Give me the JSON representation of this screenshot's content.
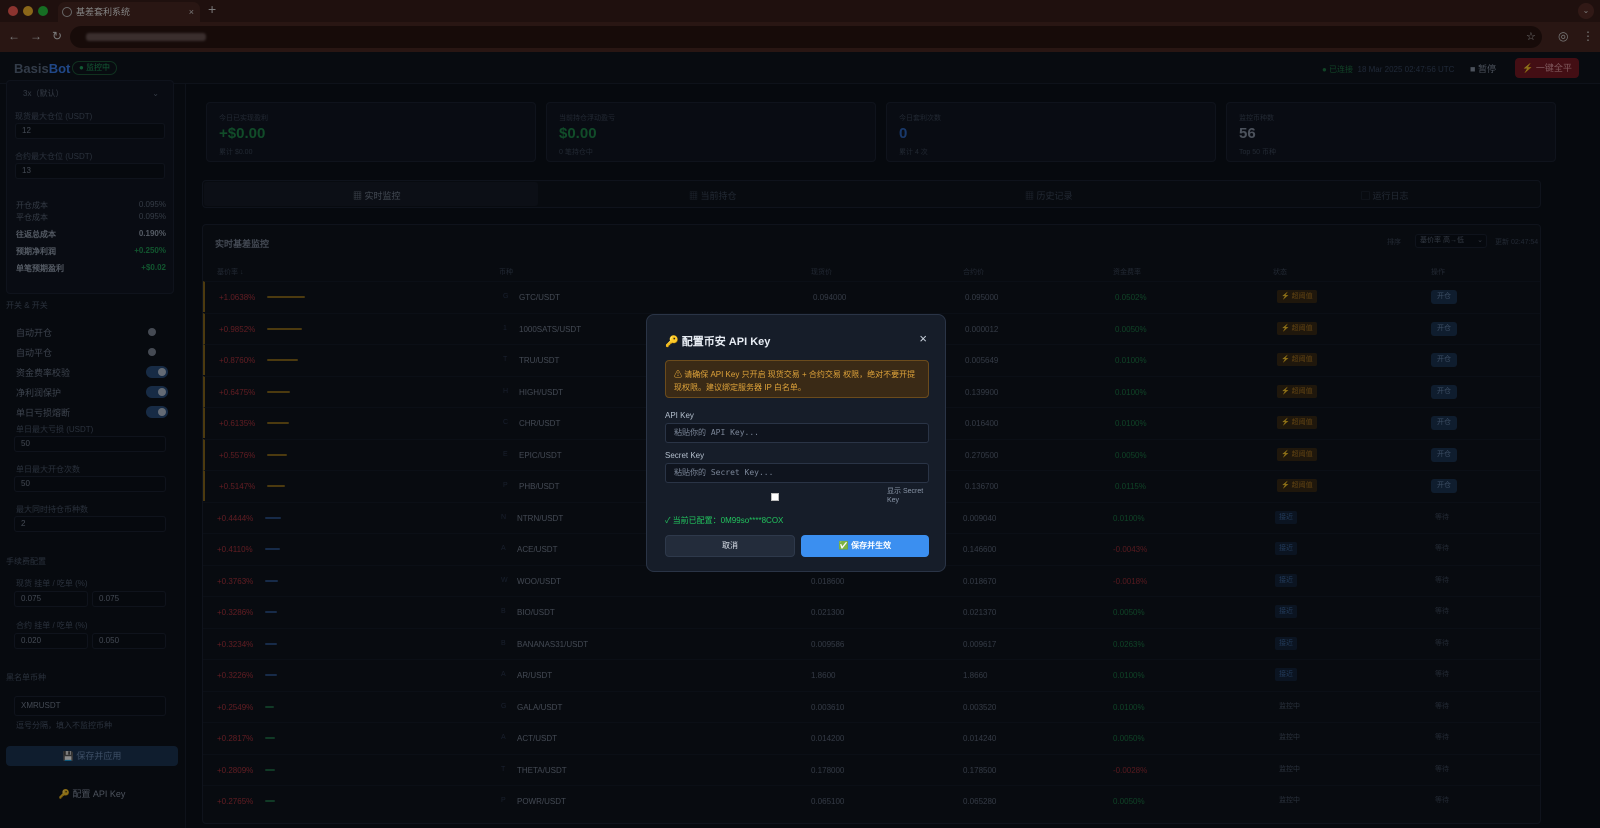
{
  "browser": {
    "tab_title": "基差套利系统",
    "new_tab": "+"
  },
  "header": {
    "brand_a": "Basis",
    "brand_b": "Bot",
    "status_badge": "● 监控中",
    "conn_status": "● 已连接",
    "datetime": "18 Mar 2025 02:47:56 UTC",
    "pause_label": "暂停",
    "close_all_label": "一键全平"
  },
  "sidebar": {
    "leverage": "3x（默认）",
    "spot_max_label": "现货最大仓位 (USDT)",
    "spot_max_value": "12",
    "fut_max_label": "合约最大仓位 (USDT)",
    "fut_max_value": "13",
    "cost_rows": [
      {
        "label": "开仓成本",
        "value": "0.095%"
      },
      {
        "label": "平仓成本",
        "value": "0.095%"
      }
    ],
    "total_cost_label": "往返总成本",
    "total_cost_value": "0.190%",
    "net_rate_label": "预期净利润",
    "net_rate_value": "+0.250%",
    "est_profit_label": "单笔预期盈利",
    "est_profit_value": "+$0.02",
    "switch_section": "开关 & 开关",
    "toggles": [
      {
        "label": "自动开仓",
        "on": false
      },
      {
        "label": "自动平仓",
        "on": false
      },
      {
        "label": "资金费率校验",
        "on": true
      },
      {
        "label": "净利润保护",
        "on": true
      },
      {
        "label": "单日亏损熔断",
        "on": true
      }
    ],
    "daily_loss_label": "单日最大亏损 (USDT)",
    "daily_loss_value": "50",
    "daily_open_label": "单日最大开仓次数",
    "daily_open_value": "50",
    "max_pos_label": "最大同时持仓币种数",
    "max_pos_value": "2",
    "fee_section": "手续费配置",
    "spot_fee_label": "现货 挂单 / 吃单 (%)",
    "spot_maker": "0.075",
    "spot_taker": "0.075",
    "fut_fee_label": "合约 挂单 / 吃单 (%)",
    "fut_maker": "0.020",
    "fut_taker": "0.050",
    "blacklist_section": "黑名单币种",
    "blacklist_value": "XMRUSDT",
    "blacklist_hint": "逗号分隔，填入不监控币种",
    "save_apply": "💾 保存并应用",
    "config_api": "🔑 配置 API Key"
  },
  "stats": [
    {
      "title": "今日已实现盈利",
      "value": "+$0.00",
      "sub": "累计 $0.00",
      "color": "#22c55e"
    },
    {
      "title": "当前持仓浮动盈亏",
      "value": "$0.00",
      "sub": "0 笔持仓中",
      "color": "#22c55e"
    },
    {
      "title": "今日套利次数",
      "value": "0",
      "sub": "累计 4 次",
      "color": "#3b82f6"
    },
    {
      "title": "监控币种数",
      "value": "56",
      "sub": "Top 50 币种",
      "color": "#c9d1dc"
    }
  ],
  "tabs": [
    {
      "label": "▦ 实时监控"
    },
    {
      "label": "▦ 当前持仓"
    },
    {
      "label": "▦ 历史记录"
    },
    {
      "label": "▢ 运行日志"
    }
  ],
  "panel": {
    "title": "实时基差监控",
    "sort_label": "排序",
    "sort_value": "基价率 高→低",
    "updated": "更新 02:47:54",
    "columns": [
      "基价率 ↓",
      "币种",
      "现货价",
      "合约价",
      "资金费率",
      "状态",
      "操作"
    ]
  },
  "rows": [
    {
      "rate": "+1.0638%",
      "icon": "G",
      "sym": "GTC/USDT",
      "spot": "0.094000",
      "fut": "0.095000",
      "fund": "0.0502%",
      "status": "⚡ 超阈值",
      "op": "开仓",
      "fundNeg": false,
      "kind": "hot"
    },
    {
      "rate": "+0.9852%",
      "icon": "1",
      "sym": "1000SATS/USDT",
      "spot": "0.000012",
      "fut": "0.000012",
      "fund": "0.0050%",
      "status": "⚡ 超阈值",
      "op": "开仓",
      "fundNeg": false,
      "kind": "hot"
    },
    {
      "rate": "+0.8760%",
      "icon": "T",
      "sym": "TRU/USDT",
      "spot": "0.005600",
      "fut": "0.005649",
      "fund": "0.0100%",
      "status": "⚡ 超阈值",
      "op": "开仓",
      "fundNeg": false,
      "kind": "hot"
    },
    {
      "rate": "+0.6475%",
      "icon": "H",
      "sym": "HIGH/USDT",
      "spot": "0.139000",
      "fut": "0.139900",
      "fund": "0.0100%",
      "status": "⚡ 超阈值",
      "op": "开仓",
      "fundNeg": false,
      "kind": "hot"
    },
    {
      "rate": "+0.6135%",
      "icon": "C",
      "sym": "CHR/USDT",
      "spot": "0.016300",
      "fut": "0.016400",
      "fund": "0.0100%",
      "status": "⚡ 超阈值",
      "op": "开仓",
      "fundNeg": false,
      "kind": "hot"
    },
    {
      "rate": "+0.5576%",
      "icon": "E",
      "sym": "EPIC/USDT",
      "spot": "0.269000",
      "fut": "0.270500",
      "fund": "0.0050%",
      "status": "⚡ 超阈值",
      "op": "开仓",
      "fundNeg": false,
      "kind": "hot"
    },
    {
      "rate": "+0.5147%",
      "icon": "P",
      "sym": "PHB/USDT",
      "spot": "0.136000",
      "fut": "0.136700",
      "fund": "0.0115%",
      "status": "⚡ 超阈值",
      "op": "开仓",
      "fundNeg": false,
      "kind": "hot"
    },
    {
      "rate": "+0.4444%",
      "icon": "N",
      "sym": "NTRN/USDT",
      "spot": "0.009000",
      "fut": "0.009040",
      "fund": "0.0100%",
      "status": "接近",
      "op": "等待",
      "fundNeg": false,
      "kind": "near"
    },
    {
      "rate": "+0.4110%",
      "icon": "A",
      "sym": "ACE/USDT",
      "spot": "0.146000",
      "fut": "0.146600",
      "fund": "-0.0043%",
      "status": "接近",
      "op": "等待",
      "fundNeg": true,
      "kind": "near"
    },
    {
      "rate": "+0.3763%",
      "icon": "W",
      "sym": "WOO/USDT",
      "spot": "0.018600",
      "fut": "0.018670",
      "fund": "-0.0018%",
      "status": "接近",
      "op": "等待",
      "fundNeg": true,
      "kind": "near"
    },
    {
      "rate": "+0.3286%",
      "icon": "B",
      "sym": "BIO/USDT",
      "spot": "0.021300",
      "fut": "0.021370",
      "fund": "0.0050%",
      "status": "接近",
      "op": "等待",
      "fundNeg": false,
      "kind": "near"
    },
    {
      "rate": "+0.3234%",
      "icon": "B",
      "sym": "BANANAS31/USDT",
      "spot": "0.009586",
      "fut": "0.009617",
      "fund": "0.0263%",
      "status": "接近",
      "op": "等待",
      "fundNeg": false,
      "kind": "near"
    },
    {
      "rate": "+0.3226%",
      "icon": "A",
      "sym": "AR/USDT",
      "spot": "1.8600",
      "fut": "1.8660",
      "fund": "0.0100%",
      "status": "接近",
      "op": "等待",
      "fundNeg": false,
      "kind": "near"
    },
    {
      "rate": "+0.2549%",
      "icon": "G",
      "sym": "GALA/USDT",
      "spot": "0.003610",
      "fut": "0.003520",
      "fund": "0.0100%",
      "status": "监控中",
      "op": "等待",
      "fundNeg": false,
      "kind": "watch"
    },
    {
      "rate": "+0.2817%",
      "icon": "A",
      "sym": "ACT/USDT",
      "spot": "0.014200",
      "fut": "0.014240",
      "fund": "0.0050%",
      "status": "监控中",
      "op": "等待",
      "fundNeg": false,
      "kind": "watch"
    },
    {
      "rate": "+0.2809%",
      "icon": "T",
      "sym": "THETA/USDT",
      "spot": "0.178000",
      "fut": "0.178500",
      "fund": "-0.0028%",
      "status": "监控中",
      "op": "等待",
      "fundNeg": true,
      "kind": "watch"
    },
    {
      "rate": "+0.2765%",
      "icon": "P",
      "sym": "POWR/USDT",
      "spot": "0.065100",
      "fut": "0.065280",
      "fund": "0.0050%",
      "status": "监控中",
      "op": "等待",
      "fundNeg": false,
      "kind": "watch"
    }
  ],
  "modal": {
    "title": "🔑 配置币安 API Key",
    "close": "×",
    "warning": "⚠ 请确保 API Key 只开启 现货交易 + 合约交易 权限，绝对不要开提现权限。建议绑定服务器 IP 白名单。",
    "api_label": "API Key",
    "api_placeholder": "粘贴你的 API Key...",
    "secret_label": "Secret Key",
    "secret_placeholder": "粘贴你的 Secret Key...",
    "show_secret": "显示 Secret Key",
    "current_config": "✓ 当前已配置：0M99so****8COX",
    "cancel": "取消",
    "save": "✅ 保存并生效"
  }
}
